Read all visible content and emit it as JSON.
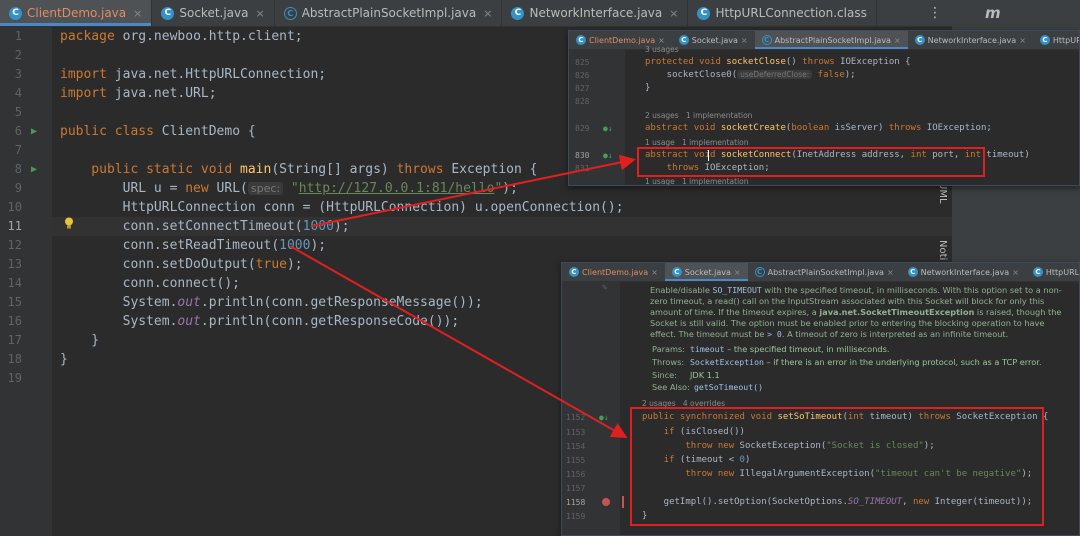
{
  "main": {
    "tabs": [
      {
        "label": "ClientDemo.java",
        "icon": "class-icon",
        "active": true
      },
      {
        "label": "Socket.java",
        "icon": "class-icon"
      },
      {
        "label": "AbstractPlainSocketImpl.java",
        "icon": "abstract-class-icon"
      },
      {
        "label": "NetworkInterface.java",
        "icon": "class-icon"
      },
      {
        "label": "HttpURLConnection.class",
        "icon": "class-icon"
      }
    ],
    "close_glyph": "×",
    "more_glyph": "⋮",
    "line_numbers": [
      "1",
      "2",
      "3",
      "4",
      "5",
      "6",
      "7",
      "8",
      "9",
      "10",
      "11",
      "12",
      "13",
      "14",
      "15",
      "16",
      "17",
      "18",
      "19"
    ],
    "code": {
      "l1_kw": "package",
      "l1_rest": " org.newboo.http.client;",
      "l3_kw": "import",
      "l3_rest": " java.net.HttpURLConnection;",
      "l4_kw": "import",
      "l4_rest": " java.net.URL;",
      "l6_kw": "public class",
      "l6_rest": " ClientDemo {",
      "l8_kw1": "    public static void ",
      "l8_fn": "main",
      "l8_mid": "(String[] args) ",
      "l8_kw2": "throws",
      "l8_rest": " Exception {",
      "l9_a": "        URL u = ",
      "l9_kw": "new",
      "l9_b": " URL(",
      "l9_hint": "spec:",
      "l9_str1": " \"",
      "l9_url": "http://127.0.0.1:81/hello",
      "l9_str2": "\"",
      "l9_end": ");",
      "l10": "        HttpURLConnection conn = (HttpURLConnection) u.openConnection();",
      "l11_a": "        conn.setConnectTimeout(",
      "l11_num": "1000",
      "l11_b": ");",
      "l12_a": "        conn.setReadTimeout(",
      "l12_num": "1000",
      "l12_b": ");",
      "l13_a": "        conn.setDoOutput(",
      "l13_kw": "true",
      "l13_b": ");",
      "l14": "        conn.connect();",
      "l15_a": "        System.",
      "l15_stat": "out",
      "l15_b": ".println(conn.getResponseMessage());",
      "l16_a": "        System.",
      "l16_stat": "out",
      "l16_b": ".println(conn.getResponseCode());",
      "l17": "    }",
      "l18": "}"
    }
  },
  "strip": {
    "letter": "m",
    "label1": "UML",
    "label2": "Noti"
  },
  "panel1": {
    "tabs": [
      "ClientDemo.java",
      "Socket.java",
      "AbstractPlainSocketImpl.java",
      "NetworkInterface.java",
      "HttpURLConnection.class"
    ],
    "usages_top": "3 usages",
    "line_numbers": [
      "825",
      "826",
      "827",
      "828",
      "829",
      "830",
      "831"
    ],
    "l825_kw": "protected void ",
    "l825_fn": "socketClose",
    "l825_b": "() ",
    "l825_kw2": "throws",
    "l825_c": " IOException {",
    "l826_a": "    socketClose0(",
    "l826_hint": "useDeferredClose:",
    "l826_kw": " false",
    "l826_b": ");",
    "l827": "}",
    "usages_829": "2 usages   1 implementation",
    "l829_kw": "abstract void ",
    "l829_fn": "socketCreate",
    "l829_a": "(",
    "l829_kw2": "boolean",
    "l829_b": " isServer) ",
    "l829_kw3": "throws",
    "l829_c": " IOException;",
    "usages_830": "1 usage   1 implementation",
    "l830_kw": "abstract void ",
    "l830_fn": "socketConnect",
    "l830_a": "(InetAddress address, ",
    "l830_kw2": "int",
    "l830_b": " port, ",
    "l830_kw3": "int",
    "l830_c": " timeout)",
    "l831_kw": "    throws",
    "l831_a": " IOException;",
    "usages_bottom": "1 usage   1 implementation"
  },
  "panel2": {
    "tabs": [
      "ClientDemo.java",
      "Socket.java",
      "AbstractPlainSocketImpl.java",
      "NetworkInterface.java",
      "HttpURLConnection.class"
    ],
    "doc1_a": "Enable/disable ",
    "doc1_code": "SO_TIMEOUT",
    "doc1_b": " with the specified timeout, in milliseconds. With this option set to a non-",
    "doc2": "zero timeout, a read() call on the InputStream associated with this Socket will block for only this",
    "doc3_a": "amount of time. If the timeout expires, a ",
    "doc3_b": "java.net.SocketTimeoutException",
    "doc3_c": " is raised, though the",
    "doc4": "Socket is still valid. The option must be enabled prior to entering the blocking operation to have",
    "doc5_a": "effect. The timeout must be ",
    "doc5_code": "> 0",
    "doc5_b": ". A timeout of zero is interpreted as an infinite timeout.",
    "params_lbl": "Params:",
    "params_code": "timeout",
    "params_val": " – the specified timeout, in milliseconds.",
    "throws_lbl": "Throws:",
    "throws_code": "SocketException",
    "throws_val": " – if there is an error in the underlying protocol, such as a TCP error.",
    "since_lbl": "Since:",
    "since_val": "JDK 1.1",
    "seealso_lbl": "See Also:",
    "seealso_code": "getSoTimeout()",
    "usages": "2 usages   4 overrides",
    "line_numbers": [
      "1152",
      "1153",
      "1154",
      "1155",
      "1156",
      "1157",
      "1158",
      "1159"
    ],
    "l1152_kw": "public synchronized void ",
    "l1152_fn": "setSoTimeout",
    "l1152_a": "(",
    "l1152_kw2": "int",
    "l1152_b": " timeout) ",
    "l1152_kw3": "throws",
    "l1152_c": " SocketException {",
    "l1153_kw": "    if",
    "l1153_a": " (isClosed())",
    "l1154_kw": "        throw new",
    "l1154_a": " SocketException(",
    "l1154_str": "\"Socket is closed\"",
    "l1154_b": ");",
    "l1155_kw": "    if",
    "l1155_a": " (timeout < ",
    "l1155_num": "0",
    "l1155_b": ")",
    "l1156_kw": "        throw new",
    "l1156_a": " IllegalArgumentException(",
    "l1156_str": "\"timeout can't be negative\"",
    "l1156_b": ");",
    "l1158_a": "    getImpl().setOption(SocketOptions.",
    "l1158_stat": "SO_TIMEOUT",
    "l1158_b": ", ",
    "l1158_kw": "new",
    "l1158_c": " Integer(timeout));",
    "l1159": "}"
  },
  "colors": {
    "highlight_box": "#e02020",
    "arrow": "#e02020",
    "active_tab_text": "#e08d61",
    "keyword": "#cc7832",
    "method": "#ffc66d",
    "string": "#6a8759",
    "number": "#6897bb"
  }
}
